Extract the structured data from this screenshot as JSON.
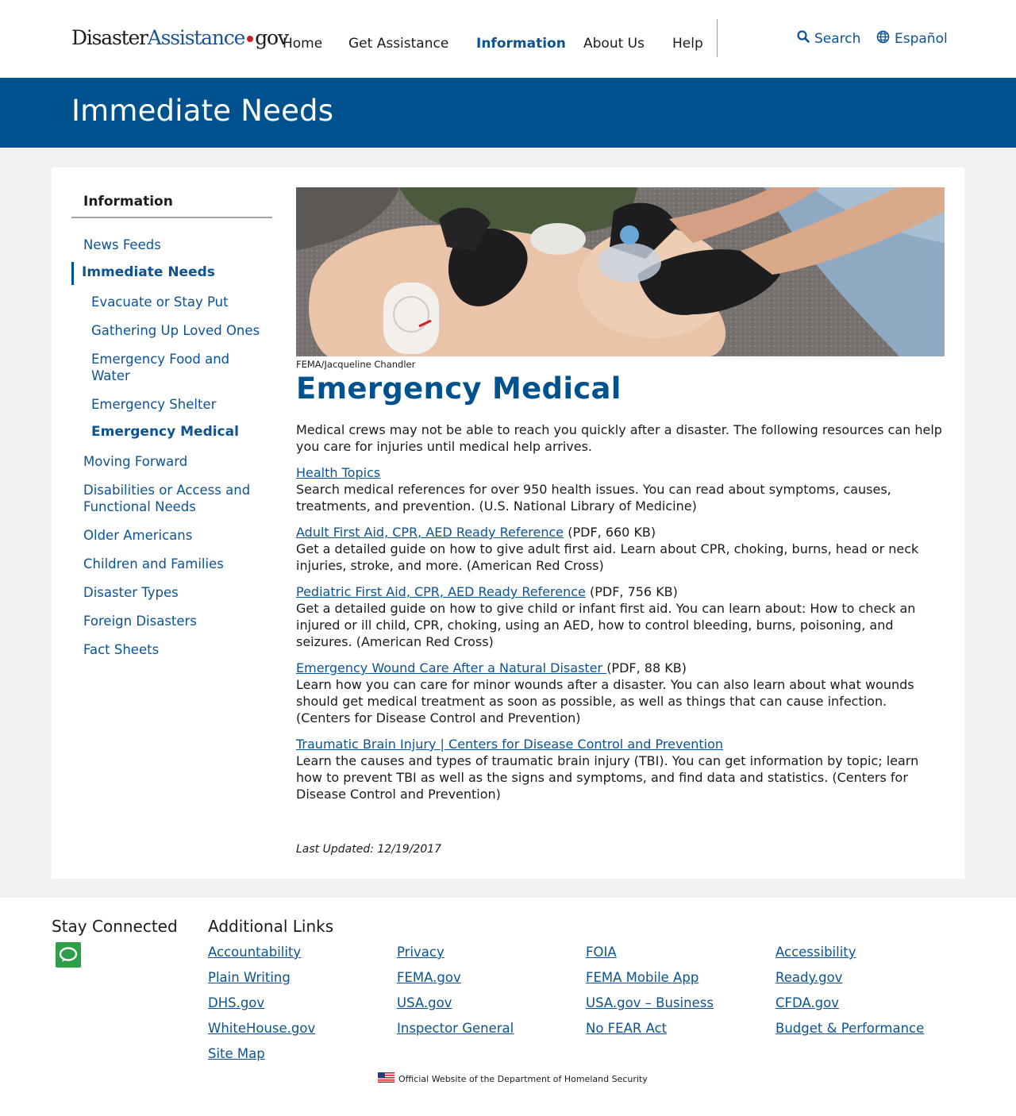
{
  "header": {
    "logo": {
      "part1": "Disaster",
      "part2": "Assistance",
      "part3": "gov"
    },
    "nav": [
      {
        "label": "Home"
      },
      {
        "label": "Get Assistance"
      },
      {
        "label": "Information",
        "active": true
      },
      {
        "label": "About Us"
      },
      {
        "label": "Help"
      }
    ],
    "search_label": "Search",
    "language_label": "Español"
  },
  "banner": {
    "title": "Immediate Needs"
  },
  "sidebar": {
    "title": "Information",
    "items": [
      {
        "label": "News Feeds"
      },
      {
        "label": "Immediate Needs",
        "current": true
      },
      {
        "label": "Evacuate or Stay Put"
      },
      {
        "label": "Gathering Up Loved Ones"
      },
      {
        "label": "Emergency Food and Water"
      },
      {
        "label": "Emergency Shelter"
      },
      {
        "label": "Emergency Medical",
        "current": true
      },
      {
        "label": "Moving Forward"
      },
      {
        "label": "Disabilities or Access and Functional Needs"
      },
      {
        "label": "Older Americans"
      },
      {
        "label": "Children and Families"
      },
      {
        "label": "Disaster Types"
      },
      {
        "label": "Foreign Disasters"
      },
      {
        "label": "Fact Sheets"
      }
    ]
  },
  "main": {
    "photo_caption": "FEMA/Jacqueline Chandler",
    "title": "Emergency Medical",
    "intro": "Medical crews may not be able to reach you quickly after a disaster. The following resources can help you care for injuries until medical help arrives.",
    "resources": [
      {
        "link": "Health Topics",
        "meta": "",
        "desc": "Search medical references for over 950 health issues. You can read about symptoms, causes, treatments, and prevention. (U.S. National Library of Medicine)"
      },
      {
        "link": "Adult First Aid, CPR, AED Ready Reference",
        "meta": " (PDF, 660 KB)",
        "desc": "Get a detailed guide on how to give adult first aid. Learn about CPR, choking, burns, head or neck injuries, stroke, and more.  (American Red Cross)"
      },
      {
        "link": "Pediatric First Aid, CPR, AED Ready Reference",
        "meta": " (PDF, 756 KB)",
        "desc": "Get a detailed guide on how to give child or infant first aid. You can learn about: How to check an injured or ill child, CPR, choking, using an AED, how to control bleeding, burns, poisoning, and seizures. (American Red Cross)"
      },
      {
        "link": "Emergency Wound Care After a Natural Disaster ",
        "meta": "(PDF, 88 KB)",
        "desc": "Learn how you can care for minor wounds after a disaster. You can also learn about what wounds should get medical treatment as soon as possible, as well as things that can cause infection. (Centers for Disease Control and Prevention)"
      },
      {
        "link": "Traumatic Brain Injury | Centers for Disease Control and Prevention",
        "meta": "",
        "desc": "Learn the causes and types of traumatic brain injury (TBI). You can get information by topic; learn how to prevent TBI as well as the signs and symptoms, and find data and statistics. (Centers for Disease Control and Prevention)"
      }
    ],
    "last_updated": "Last Updated: 12/19/2017"
  },
  "footer": {
    "stay_connected": "Stay Connected",
    "additional_links_title": "Additional Links",
    "columns": [
      [
        "Accountability",
        "Plain Writing",
        "DHS.gov",
        "WhiteHouse.gov",
        "Site Map"
      ],
      [
        "Privacy",
        "FEMA.gov",
        "USA.gov",
        "Inspector General"
      ],
      [
        "FOIA",
        "FEMA Mobile App",
        "USA.gov – Business",
        "No FEAR Act"
      ],
      [
        "Accessibility",
        "Ready.gov",
        "CFDA.gov",
        "Budget & Performance"
      ]
    ],
    "official": "Official Website of the Department of Homeland Security"
  },
  "colors": {
    "brand_blue": "#00528e",
    "link_blue": "#0b5394",
    "logo_red": "#cd2026",
    "chat_green": "#2e9e48"
  }
}
